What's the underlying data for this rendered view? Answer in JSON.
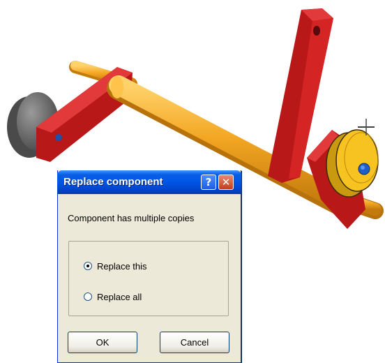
{
  "dialog": {
    "title": "Replace component",
    "help_label": "?",
    "close_label": "✕",
    "message": "Component has multiple copies",
    "options": [
      {
        "label": "Replace this",
        "selected": true
      },
      {
        "label": "Replace all",
        "selected": false
      }
    ],
    "ok_label": "OK",
    "cancel_label": "Cancel"
  },
  "scene": {
    "shaft_color": "#f3a623",
    "bracket_color": "#b81818",
    "wheel_color": "#666666",
    "pulley_color": "#f7c320",
    "bolt_color": "#1f5fc7",
    "cursor_icon": "crosshair-cursor-icon"
  }
}
